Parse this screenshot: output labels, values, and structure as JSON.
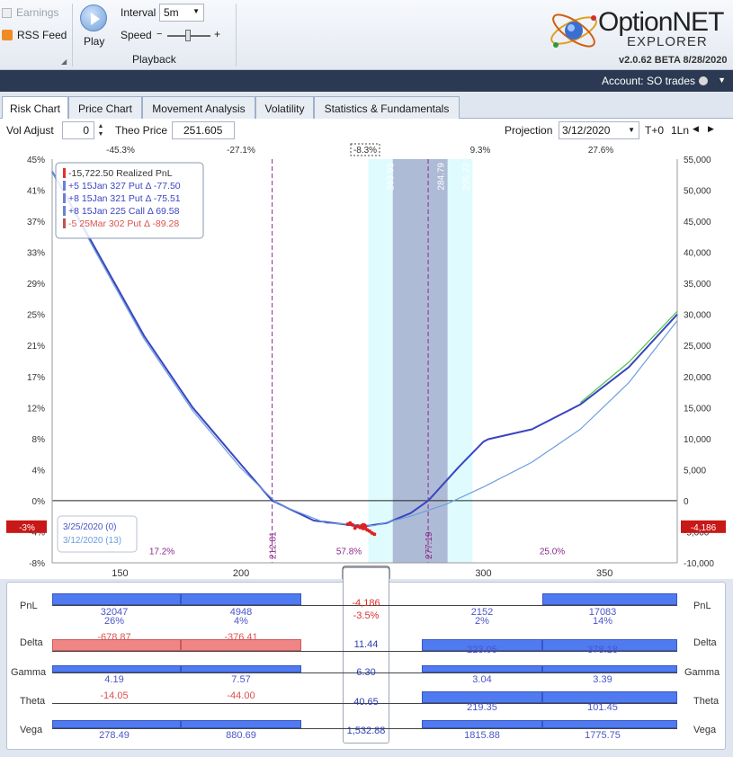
{
  "ribbon": {
    "earnings_label": "Earnings",
    "rss_label": "RSS Feed",
    "play_label": "Play",
    "interval_label": "Interval",
    "interval_value": "5m",
    "speed_label": "Speed",
    "group_label": "Playback",
    "logo_main": "OptionNET",
    "logo_sub": "EXPLORER",
    "version": "v2.0.62 BETA 8/28/2020"
  },
  "account": {
    "label": "Account: SO trades"
  },
  "tabs": [
    "Risk Chart",
    "Price Chart",
    "Movement Analysis",
    "Volatility",
    "Statistics & Fundamentals"
  ],
  "controls": {
    "vol_adjust_label": "Vol Adjust",
    "vol_adjust_value": "0",
    "theo_label": "Theo Price",
    "theo_value": "251.605",
    "projection_label": "Projection",
    "projection_date": "3/12/2020",
    "tplus": "T+0",
    "lines": "1Ln"
  },
  "chart": {
    "top_pcts": [
      "-45.3%",
      "-27.1%",
      "-8.3%",
      "9.3%",
      "27.6%"
    ],
    "left_axis": [
      "45%",
      "41%",
      "37%",
      "33%",
      "29%",
      "25%",
      "21%",
      "17%",
      "12%",
      "8%",
      "4%",
      "0%",
      "-4%",
      "-8%"
    ],
    "right_axis": [
      "55,000",
      "50,000",
      "45,000",
      "40,000",
      "35,000",
      "30,000",
      "25,000",
      "20,000",
      "15,000",
      "10,000",
      "5,000",
      "0",
      "-5,000",
      "-10,000"
    ],
    "x_axis": [
      "150",
      "200",
      "250",
      "300",
      "350"
    ],
    "price_marker": "251.605",
    "left_flag": "-3%",
    "right_flag": "-4,186",
    "vlines": [
      "212.81",
      "277.19"
    ],
    "band_labels": [
      "253.50",
      "263.93",
      "284.79",
      "295.22"
    ],
    "zone_pcts": [
      "17.2%",
      "57.8%",
      "25.0%"
    ],
    "legend": [
      {
        "text": "-15,722.50 Realized PnL",
        "color": "#333333"
      },
      {
        "text": "+5 15Jan 327 Put Δ  -77.50",
        "color": "#3a45c0"
      },
      {
        "text": "+8 15Jan 321 Put Δ  -75.51",
        "color": "#3a45c0"
      },
      {
        "text": "+8 15Jan 225 Call Δ   69.58",
        "color": "#3a45c0"
      },
      {
        "text": "-5 25Mar 302 Put Δ  -89.28",
        "color": "#d9534f"
      }
    ],
    "date_legend": [
      "3/25/2020 (0)",
      "3/12/2020 (13)"
    ]
  },
  "chart_data": {
    "type": "line",
    "xlabel": "",
    "ylabel": "",
    "xlim": [
      122,
      380
    ],
    "ylim": [
      -10000,
      55000
    ],
    "series": [
      {
        "name": "3/25/2020 (0)",
        "x": [
          122,
          140,
          160,
          180,
          200,
          212.81,
          230,
          250,
          260,
          270,
          277.19,
          290,
          300,
          302,
          320,
          340,
          360,
          380
        ],
        "y": [
          53000,
          40500,
          26500,
          15000,
          5800,
          0,
          -3200,
          -4186,
          -3600,
          -2000,
          0,
          5500,
          9500,
          9900,
          11500,
          15500,
          21500,
          30000
        ]
      },
      {
        "name": "3/12/2020 (13)",
        "x": [
          122,
          140,
          160,
          180,
          200,
          215,
          235,
          255,
          270,
          285,
          300,
          320,
          340,
          360,
          380
        ],
        "y": [
          53000,
          40000,
          26000,
          14500,
          5200,
          -500,
          -3600,
          -4000,
          -2500,
          -500,
          2200,
          6200,
          11500,
          19000,
          29000
        ]
      }
    ]
  },
  "greeks": {
    "rows": [
      {
        "label": "PnL",
        "mid": "-4,186",
        "mid2": "-3.5%",
        "cols": [
          {
            "v": "32047",
            "p": "26%"
          },
          {
            "v": "4948",
            "p": "4%"
          },
          {
            "v": "2152",
            "p": "2%"
          },
          {
            "v": "17083",
            "p": "14%"
          }
        ]
      },
      {
        "label": "Delta",
        "mid": "11.44",
        "cols": [
          {
            "v": "-678.87"
          },
          {
            "v": "-376.41"
          },
          {
            "v": "223.05"
          },
          {
            "v": "378.18"
          }
        ]
      },
      {
        "label": "Gamma",
        "mid": "6.30",
        "cols": [
          {
            "v": "4.19"
          },
          {
            "v": "7.57"
          },
          {
            "v": "3.04"
          },
          {
            "v": "3.39"
          }
        ]
      },
      {
        "label": "Theta",
        "mid": "40.65",
        "cols": [
          {
            "v": "-14.05"
          },
          {
            "v": "-44.00"
          },
          {
            "v": "219.35"
          },
          {
            "v": "101.45"
          }
        ]
      },
      {
        "label": "Vega",
        "mid": "1,532.88",
        "cols": [
          {
            "v": "278.49"
          },
          {
            "v": "880.69"
          },
          {
            "v": "1815.88"
          },
          {
            "v": "1775.75"
          }
        ]
      }
    ]
  }
}
